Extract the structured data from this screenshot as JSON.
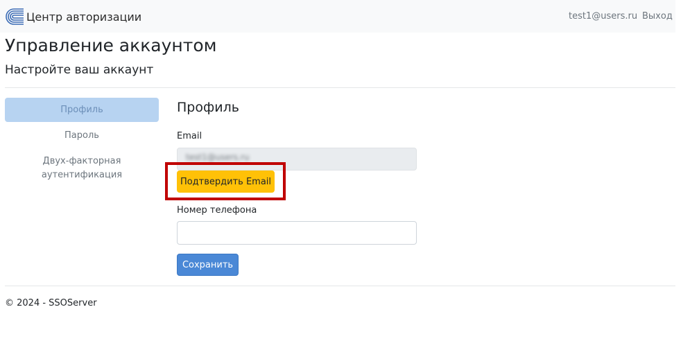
{
  "navbar": {
    "brand_icon": "sso-logo-icon",
    "brand_color": "#3a6bb5",
    "brand_text": "Центр авторизации",
    "user_email": "test1@users.ru",
    "logout_label": "Выход"
  },
  "header": {
    "title": "Управление аккаунтом",
    "subtitle": "Настройте ваш аккаунт"
  },
  "sidebar": {
    "items": [
      {
        "label": "Профиль",
        "active": true
      },
      {
        "label": "Пароль"
      },
      {
        "label": "Двух-факторная аутентификация"
      }
    ]
  },
  "profile": {
    "section_title": "Профиль",
    "email_label": "Email",
    "email_value": "test1@users.ru",
    "confirm_email_label": "Подтвердить Email",
    "phone_label": "Номер телефона",
    "phone_value": "",
    "save_label": "Сохранить"
  },
  "colors": {
    "accent": "#4a88d6",
    "warning": "#ffc107",
    "highlight": "#c00000"
  },
  "footer": {
    "text": "© 2024 - SSOServer"
  }
}
